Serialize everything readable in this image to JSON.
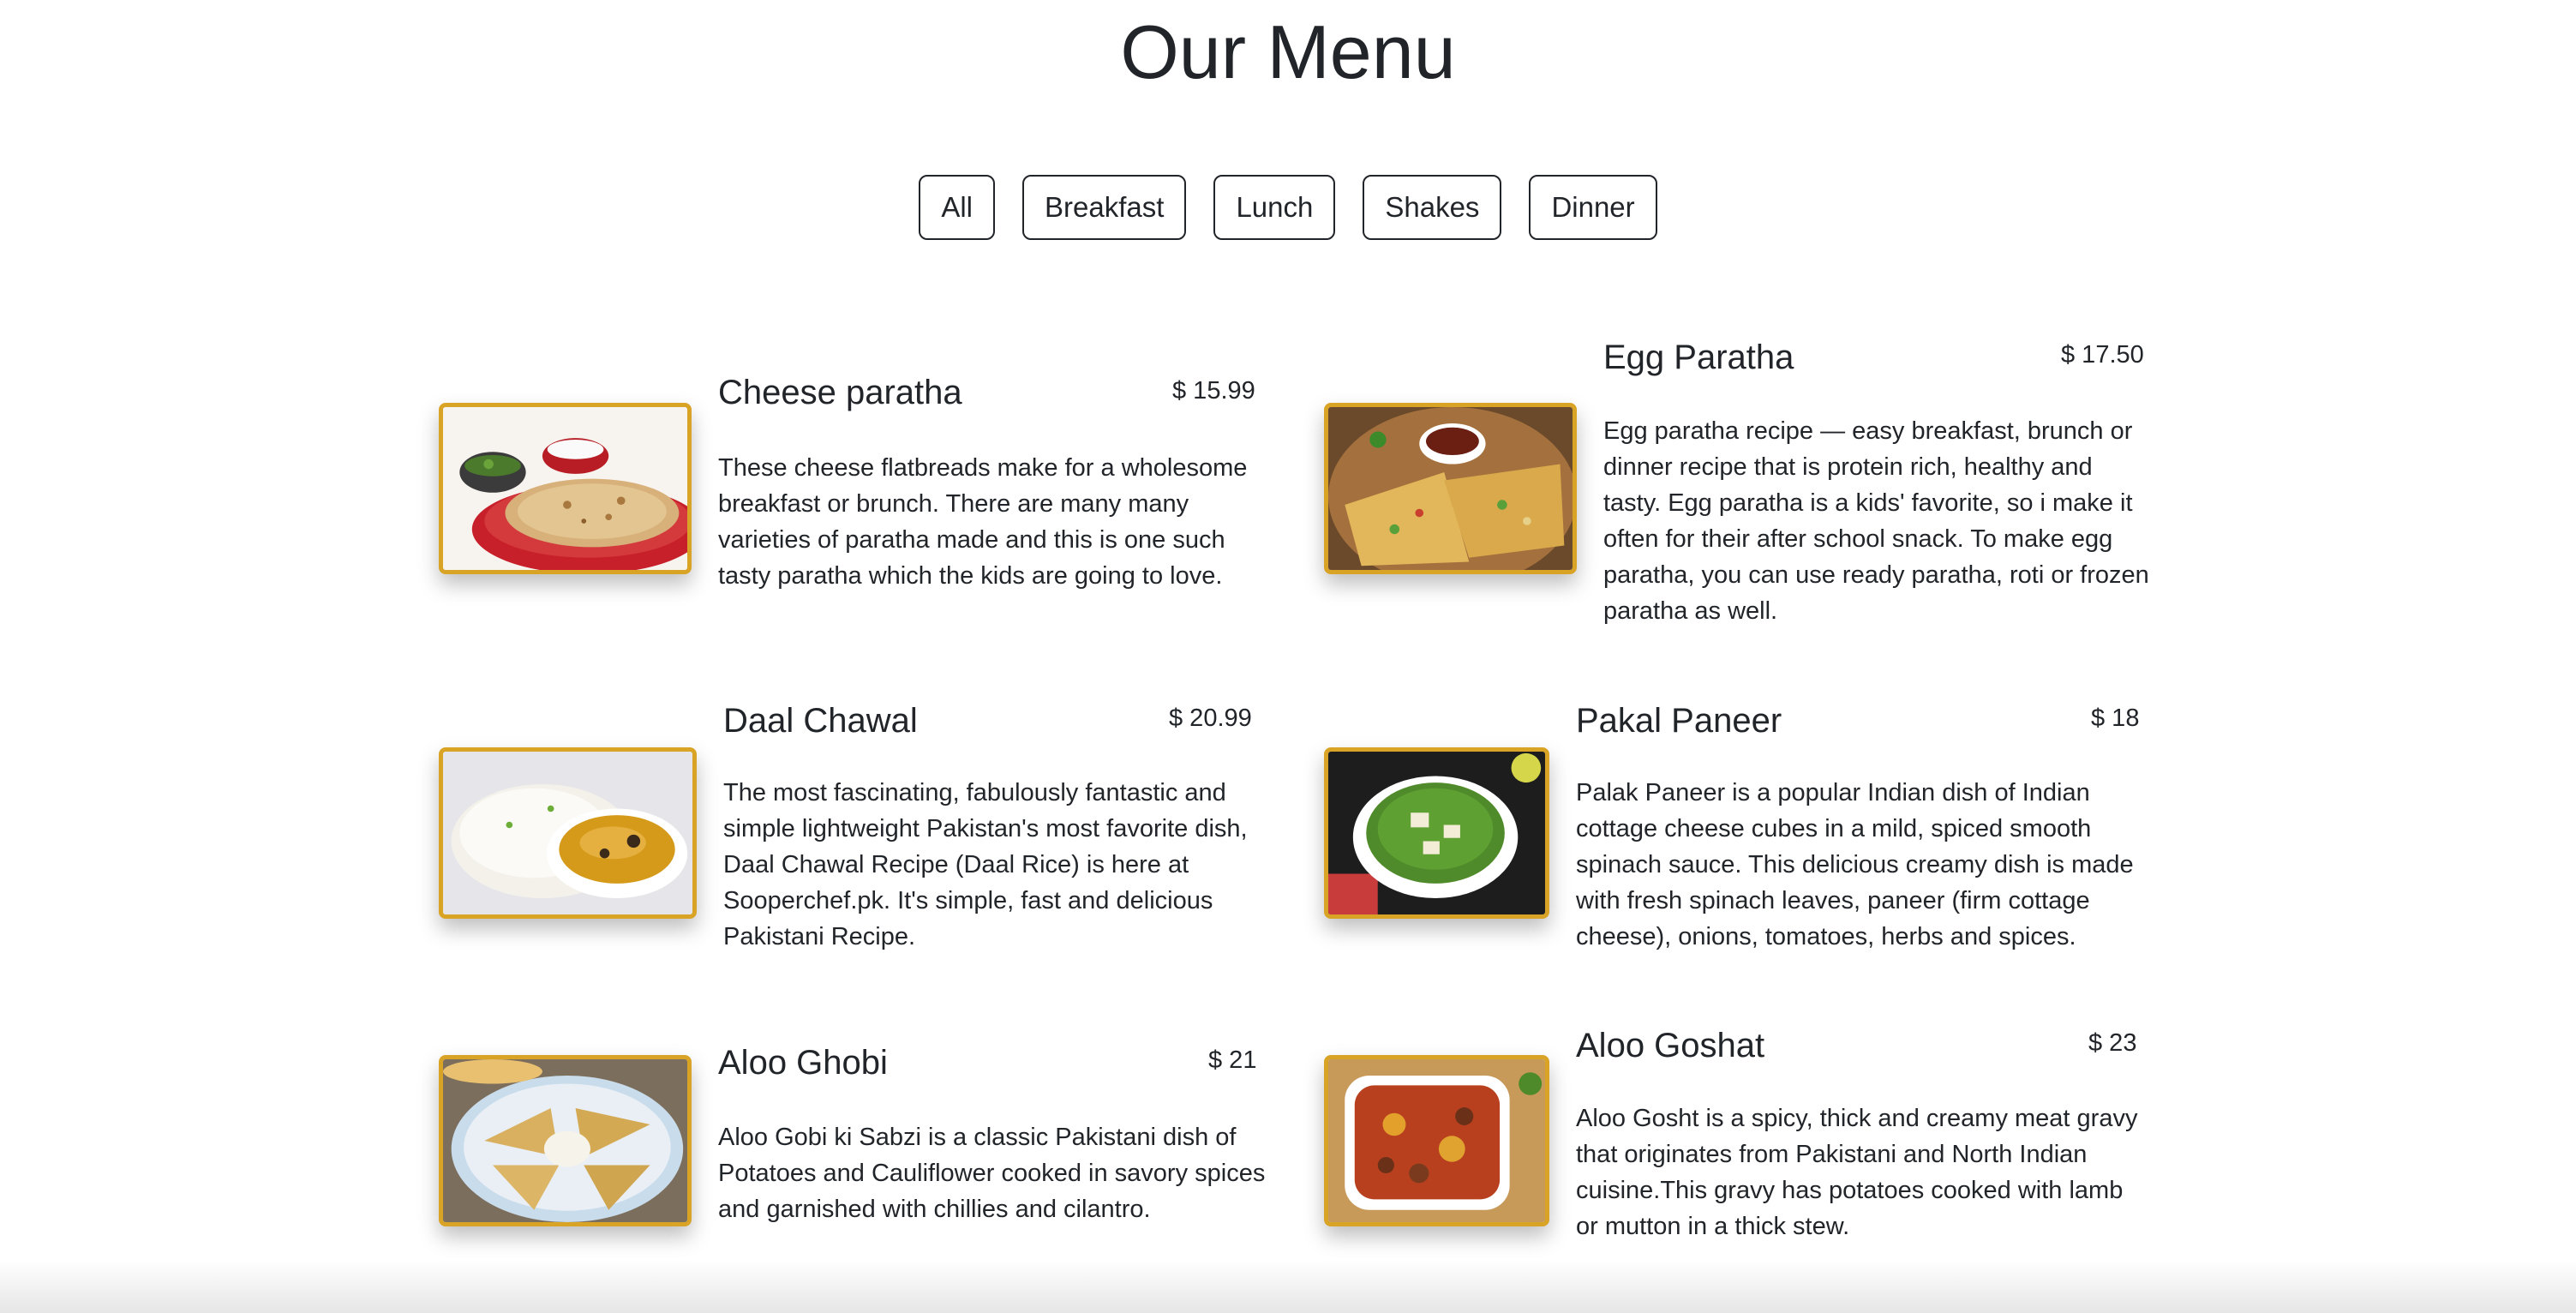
{
  "page": {
    "title": "Our Menu"
  },
  "filters": [
    {
      "label": "All"
    },
    {
      "label": "Breakfast"
    },
    {
      "label": "Lunch"
    },
    {
      "label": "Shakes"
    },
    {
      "label": "Dinner"
    }
  ],
  "theme": {
    "accent_border": "#d9a326",
    "text": "#212529",
    "background": "#ffffff"
  },
  "menu_items": [
    {
      "name": "Cheese paratha",
      "price": "$ 15.99",
      "description": "These cheese flatbreads make for a wholesome breakfast or brunch. There are many many varieties of paratha made and this is one such tasty paratha which the kids are going to love."
    },
    {
      "name": "Egg Paratha",
      "price": "$ 17.50",
      "description": "Egg paratha recipe — easy breakfast, brunch or dinner recipe that is protein rich, healthy and tasty. Egg paratha is a kids' favorite, so i make it often for their after school snack. To make egg paratha, you can use ready paratha, roti or frozen paratha as well."
    },
    {
      "name": "Daal Chawal",
      "price": "$ 20.99",
      "description": "The most fascinating, fabulously fantastic and simple lightweight Pakistan's most favorite dish, Daal Chawal Recipe (Daal Rice) is here at Sooperchef.pk. It's simple, fast and delicious Pakistani Recipe."
    },
    {
      "name": "Pakal Paneer",
      "price": "$ 18",
      "description": "Palak Paneer is a popular Indian dish of Indian cottage cheese cubes in a mild, spiced smooth spinach sauce. This delicious creamy dish is made with fresh spinach leaves, paneer (firm cottage cheese), onions, tomatoes, herbs and spices."
    },
    {
      "name": "Aloo Ghobi",
      "price": "$ 21",
      "description": "Aloo Gobi ki Sabzi is a classic Pakistani dish of Potatoes and Cauliflower cooked in savory spices and garnished with chillies and cilantro."
    },
    {
      "name": "Aloo Goshat",
      "price": "$ 23",
      "description": "Aloo Gosht is a spicy, thick and creamy meat gravy that originates from Pakistani and North Indian cuisine.This gravy has potatoes cooked with lamb or mutton in a thick stew."
    }
  ]
}
